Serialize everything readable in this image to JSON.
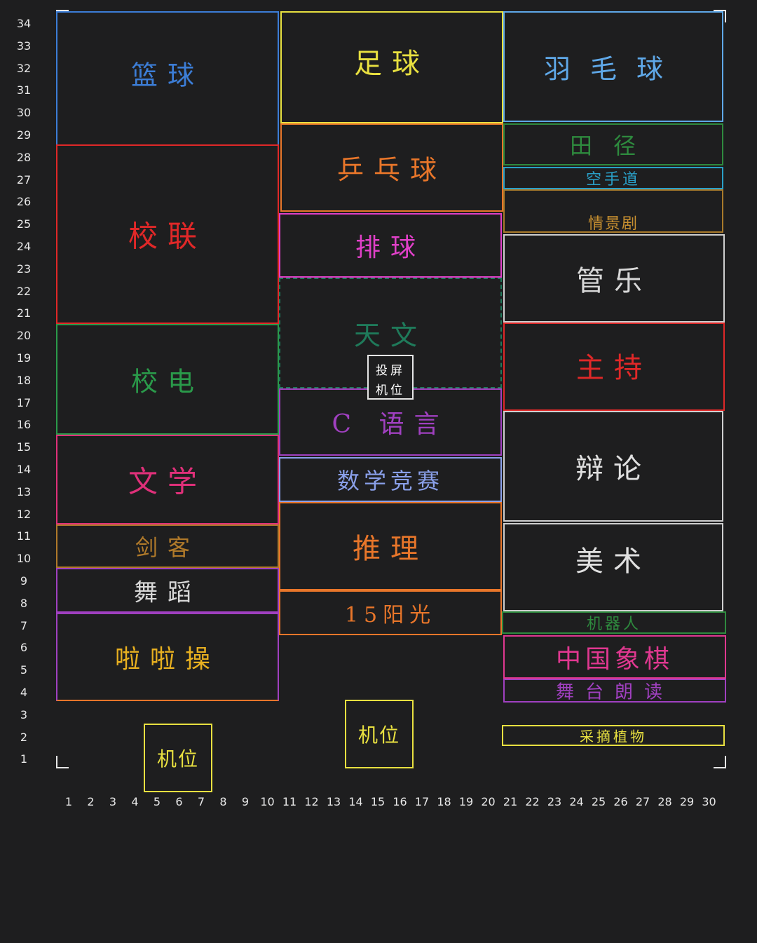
{
  "zones": [
    {
      "id": "basketball",
      "label": "篮球",
      "color": "#3c7dd6"
    },
    {
      "id": "football",
      "label": "足球",
      "color": "#e8e040"
    },
    {
      "id": "badminton",
      "label": "羽毛球",
      "color": "#5fa8e8"
    },
    {
      "id": "pingpong",
      "label": "乒乓球",
      "color": "#e8762a"
    },
    {
      "id": "track",
      "label": "田径",
      "color": "#2e8a3e"
    },
    {
      "id": "karate",
      "label": "空手道",
      "color": "#2aa0c8"
    },
    {
      "id": "drama",
      "label": "情景剧",
      "color": "#a87a2a"
    },
    {
      "id": "campus-band",
      "label": "校联",
      "color": "#e02828"
    },
    {
      "id": "volleyball",
      "label": "排球",
      "color": "#e040c8"
    },
    {
      "id": "wind-music",
      "label": "管乐",
      "color": "#cfcfcf"
    },
    {
      "id": "astronomy",
      "label": "天文",
      "color": "#1f7a5a"
    },
    {
      "id": "radio",
      "label": "校电",
      "color": "#2a9a4a"
    },
    {
      "id": "host",
      "label": "主持",
      "color": "#e02828"
    },
    {
      "id": "c-language",
      "label": "C 语言",
      "color": "#a040c0"
    },
    {
      "id": "literature",
      "label": "文学",
      "color": "#e0307a"
    },
    {
      "id": "debate",
      "label": "辩论",
      "color": "#cfcfcf"
    },
    {
      "id": "math-contest",
      "label": "数学竞赛",
      "color": "#8aa0ea"
    },
    {
      "id": "reasoning",
      "label": "推理",
      "color": "#e8762a"
    },
    {
      "id": "fencing",
      "label": "剑客",
      "color": "#b07a2a"
    },
    {
      "id": "art",
      "label": "美术",
      "color": "#cfcfcf"
    },
    {
      "id": "dance",
      "label": "舞蹈",
      "color": "#a040c0"
    },
    {
      "id": "sunshine",
      "label": "15阳光",
      "color": "#e8762a"
    },
    {
      "id": "robot",
      "label": "机器人",
      "color": "#2e8a3e"
    },
    {
      "id": "cheerleading",
      "label": "啦啦操",
      "color": "#a040c0"
    },
    {
      "id": "chess",
      "label": "中国象棋",
      "color": "#e03890"
    },
    {
      "id": "recital",
      "label": "舞台朗读",
      "color": "#a040c0"
    },
    {
      "id": "botany",
      "label": "采摘植物",
      "color": "#e8e040"
    }
  ],
  "machine_spots": [
    {
      "id": "projector",
      "label1": "投屏",
      "label2": "机位",
      "color": "#e6e6e6"
    },
    {
      "id": "camera-left",
      "label": "机位",
      "color": "#e8e040"
    },
    {
      "id": "camera-center",
      "label": "机位",
      "color": "#e8e040"
    }
  ],
  "y_ticks": [
    "34",
    "33",
    "32",
    "31",
    "30",
    "29",
    "28",
    "27",
    "26",
    "25",
    "24",
    "23",
    "22",
    "21",
    "20",
    "19",
    "18",
    "17",
    "16",
    "15",
    "14",
    "13",
    "12",
    "11",
    "10",
    "9",
    "8",
    "7",
    "6",
    "5",
    "4",
    "3",
    "2",
    "1"
  ],
  "x_ticks": [
    "1",
    "2",
    "3",
    "4",
    "5",
    "6",
    "7",
    "8",
    "9",
    "10",
    "11",
    "12",
    "13",
    "14",
    "15",
    "16",
    "17",
    "18",
    "19",
    "20",
    "21",
    "22",
    "23",
    "24",
    "25",
    "26",
    "27",
    "28",
    "29",
    "30"
  ]
}
